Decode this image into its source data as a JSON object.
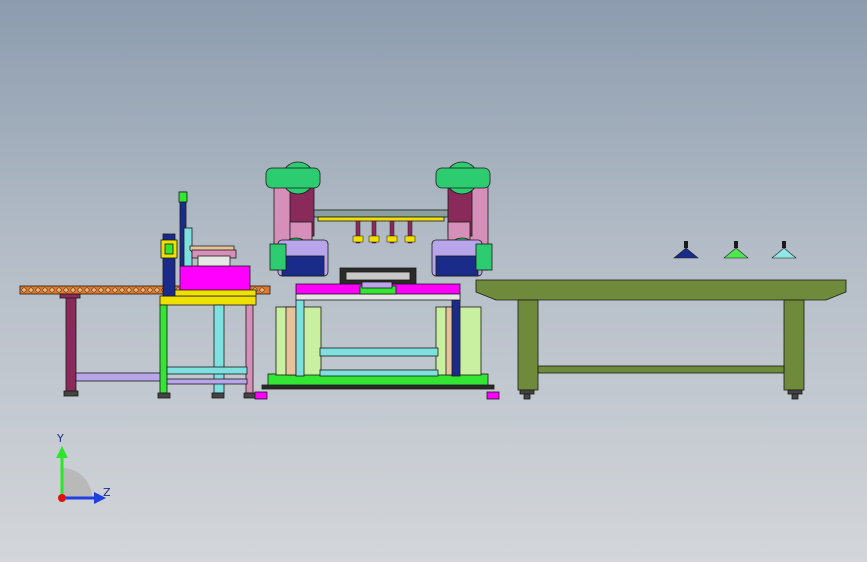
{
  "viewport": {
    "background_top": "#8c9cae",
    "background_bottom": "#d3d6da",
    "line_color": "#1a1a1a"
  },
  "palette": {
    "conveyor": "#e07a2a",
    "magenta": "#ff00ff",
    "green": "#33e633",
    "cyan": "#7fe0e0",
    "purple": "#8a2a5a",
    "lavender": "#b9a6ea",
    "yellow": "#f0e000",
    "olive": "#6e8a3a",
    "navy": "#1a2b8a",
    "light_green": "#c8f0a0",
    "robot_green": "#2ecc71",
    "robot_pink": "#d68fb8"
  },
  "triad": {
    "y_label": "Y",
    "z_label": "Z",
    "y_color": "#2ee52e",
    "z_color": "#1f3fe0",
    "origin_color": "#e01010"
  },
  "markers": [
    {
      "name": "marker-navy",
      "color": "#1a2b8a"
    },
    {
      "name": "marker-green",
      "color": "#4fe84f"
    },
    {
      "name": "marker-cyan",
      "color": "#8fe6e6"
    }
  ]
}
